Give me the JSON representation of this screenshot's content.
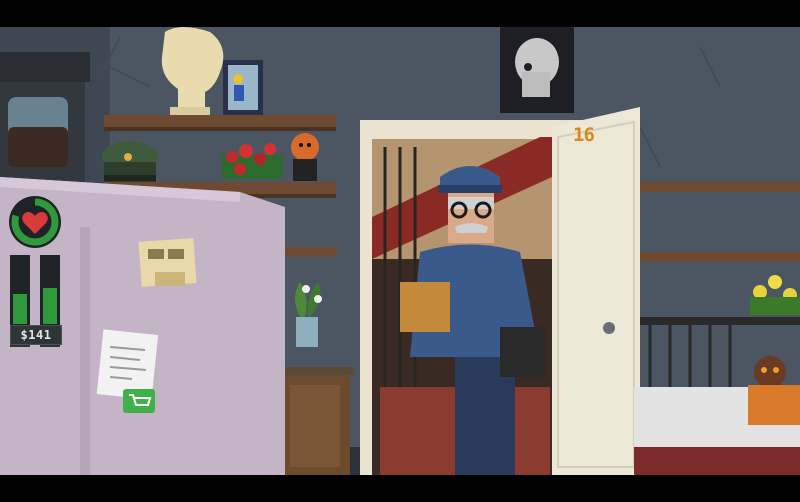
{
  "game": {
    "hud": {
      "money": "$141",
      "health_icon": "heart-icon",
      "sleep_icon": "zzz-icon",
      "food_icon": "drumstick-icon",
      "energy_level": 0.45,
      "hunger_level": 0.55,
      "health_ring_level": 0.8
    },
    "scene": {
      "door_number": "16",
      "fridge_note_icon": "shopping-cart-icon"
    },
    "colors": {
      "wall": "#4c5562",
      "fridge": "#c3b4c6",
      "hud_green": "#2f9a3b",
      "heart_red": "#d93a3a",
      "uniform_blue": "#3b5a8c",
      "door_number": "#d58a1c"
    }
  }
}
